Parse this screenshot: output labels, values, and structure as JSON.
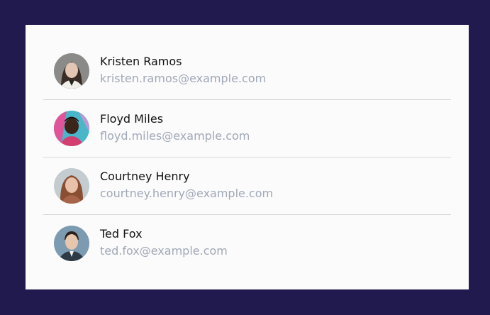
{
  "colors": {
    "background": "#211a4e",
    "card": "#fbfbfb",
    "name_text": "#111111",
    "email_text": "#a0a8b8",
    "divider": "#d6d6d6"
  },
  "people": [
    {
      "name": "Kristen Ramos",
      "email": "kristen.ramos@example.com",
      "avatar": "avatar-photo"
    },
    {
      "name": "Floyd Miles",
      "email": "floyd.miles@example.com",
      "avatar": "avatar-photo"
    },
    {
      "name": "Courtney Henry",
      "email": "courtney.henry@example.com",
      "avatar": "avatar-photo"
    },
    {
      "name": "Ted Fox",
      "email": "ted.fox@example.com",
      "avatar": "avatar-photo"
    }
  ]
}
